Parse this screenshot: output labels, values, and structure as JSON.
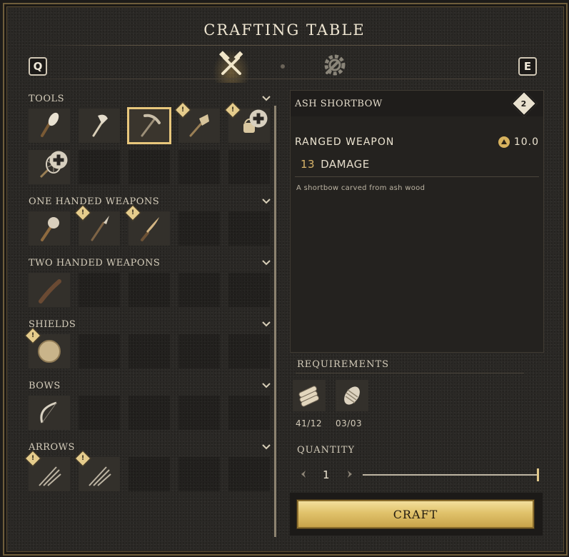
{
  "window": {
    "title": "CRAFTING TABLE"
  },
  "hotkeys": {
    "prev": "Q",
    "next": "E"
  },
  "tabs": [
    {
      "name": "crafting",
      "icon": "hammer-crossed-icon",
      "active": true
    },
    {
      "name": "upgrades",
      "icon": "gear-wrench-icon",
      "active": false
    }
  ],
  "categories": [
    {
      "label": "TOOLS",
      "rows": [
        [
          {
            "icon": "torch-icon"
          },
          {
            "icon": "axe-icon"
          },
          {
            "icon": "pickaxe-icon",
            "selected": true
          },
          {
            "icon": "shovel-icon",
            "alert": true
          },
          {
            "icon": "watering-can-icon",
            "alert": true,
            "new": true
          }
        ],
        [
          {
            "icon": "net-icon",
            "new": true
          },
          {
            "empty": true
          },
          {
            "empty": true
          },
          {
            "empty": true
          },
          {
            "empty": true
          }
        ]
      ]
    },
    {
      "label": "ONE HANDED WEAPONS",
      "rows": [
        [
          {
            "icon": "mace-icon"
          },
          {
            "icon": "spear-icon",
            "alert": true
          },
          {
            "icon": "knife-icon",
            "alert": true
          },
          {
            "empty": true
          },
          {
            "empty": true
          }
        ]
      ]
    },
    {
      "label": "TWO HANDED WEAPONS",
      "rows": [
        [
          {
            "icon": "greatsword-icon"
          },
          {
            "empty": true
          },
          {
            "empty": true
          },
          {
            "empty": true
          },
          {
            "empty": true
          }
        ]
      ]
    },
    {
      "label": "SHIELDS",
      "rows": [
        [
          {
            "icon": "round-shield-icon",
            "alert": true
          },
          {
            "empty": true
          },
          {
            "empty": true
          },
          {
            "empty": true
          },
          {
            "empty": true
          }
        ]
      ]
    },
    {
      "label": "BOWS",
      "rows": [
        [
          {
            "icon": "bow-icon"
          },
          {
            "empty": true
          },
          {
            "empty": true
          },
          {
            "empty": true
          },
          {
            "empty": true
          }
        ]
      ]
    },
    {
      "label": "ARROWS",
      "rows": [
        [
          {
            "icon": "arrows-icon",
            "alert": true
          },
          {
            "icon": "arrows-icon",
            "alert": true
          },
          {
            "empty": true
          },
          {
            "empty": true
          },
          {
            "empty": true
          }
        ]
      ]
    }
  ],
  "detail": {
    "name": "ASH SHORTBOW",
    "tier": "2",
    "type": "RANGED WEAPON",
    "weight": "10.0",
    "damage_value": "13",
    "damage_label": "DAMAGE",
    "description": "A shortbow carved from ash wood"
  },
  "requirements": {
    "title": "REQUIREMENTS",
    "items": [
      {
        "icon": "logs-icon",
        "count": "41/12"
      },
      {
        "icon": "fiber-bundle-icon",
        "count": "03/03"
      }
    ]
  },
  "quantity": {
    "title": "QUANTITY",
    "value": "1"
  },
  "craft": {
    "label": "CRAFT"
  },
  "alert_symbol": "!",
  "colors": {
    "gold": "#e8c77c",
    "panel": "#2b2926"
  }
}
